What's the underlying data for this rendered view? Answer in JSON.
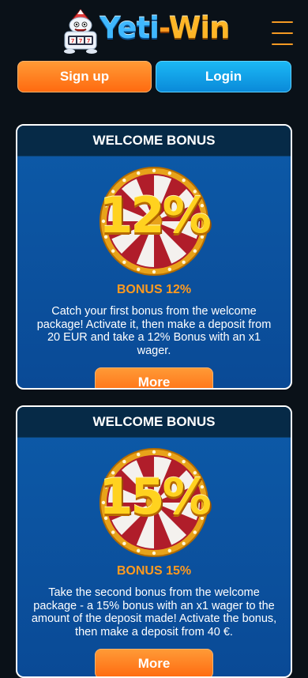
{
  "header": {
    "logo_text_1": "Yeti",
    "logo_text_dash": "-",
    "logo_text_2": "Win",
    "menu_icon": "hamburger-menu-icon"
  },
  "auth": {
    "signup_label": "Sign up",
    "login_label": "Login"
  },
  "promos": [
    {
      "heading": "WELCOME BONUS",
      "percent": "12%",
      "title": "BONUS 12%",
      "description": "Catch your first bonus from the welcome package! Activate it, then make a deposit from 20 EUR and take a 12% Bonus with an x1 wager.",
      "button": "More"
    },
    {
      "heading": "WELCOME BONUS",
      "percent": "15%",
      "title": "BONUS 15%",
      "description": "Take the second bonus from the welcome package - a 15% bonus with an x1 wager to the amount of the deposit made! Activate the bonus, then make a deposit from 40 €.",
      "button": "More"
    }
  ],
  "colors": {
    "background": "#0a1118",
    "accent_orange": "#ff7a1f",
    "accent_blue": "#0aa0e8",
    "card_blue": "#0d5aa8",
    "card_header": "#062a47",
    "gold": "#ffd21f"
  }
}
